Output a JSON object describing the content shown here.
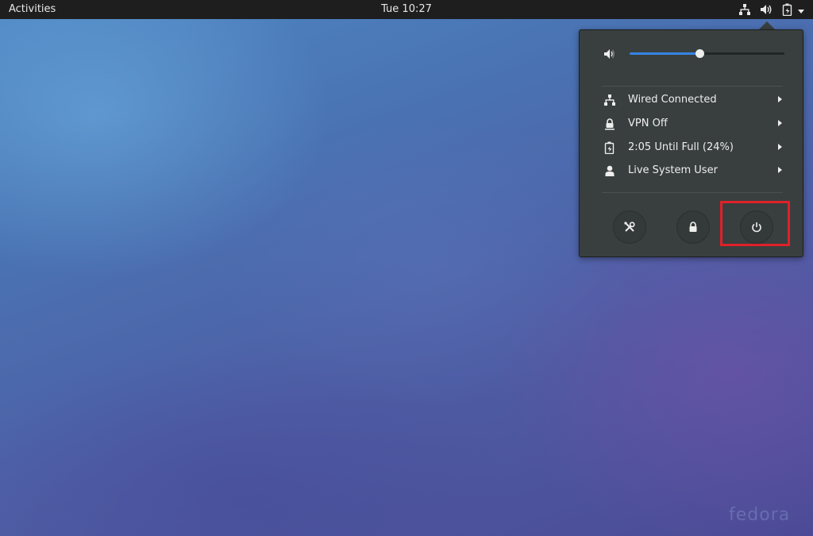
{
  "top_bar": {
    "activities_label": "Activities",
    "clock": "Tue 10:27",
    "tray_icons": [
      "network-wired-icon",
      "volume-icon",
      "battery-charging-icon",
      "chevron-down-icon"
    ]
  },
  "system_menu": {
    "volume": {
      "icon": "volume-low-icon",
      "level_fraction": 0.45
    },
    "items": [
      {
        "icon": "network-wired-icon",
        "label": "Wired Connected"
      },
      {
        "icon": "vpn-lock-icon",
        "label": "VPN Off"
      },
      {
        "icon": "battery-charging-icon",
        "label": "2:05 Until Full (24%)"
      },
      {
        "icon": "user-icon",
        "label": "Live System User"
      }
    ],
    "buttons": [
      {
        "name": "settings-button",
        "icon": "settings-tools-icon"
      },
      {
        "name": "lock-button",
        "icon": "lock-icon"
      },
      {
        "name": "power-button",
        "icon": "power-icon"
      }
    ]
  },
  "colors": {
    "top_bar": "#1e1e1e",
    "menu_bg": "#393f3f",
    "accent": "#3584e4",
    "highlight": "#e0202a"
  },
  "watermark": "fedora"
}
